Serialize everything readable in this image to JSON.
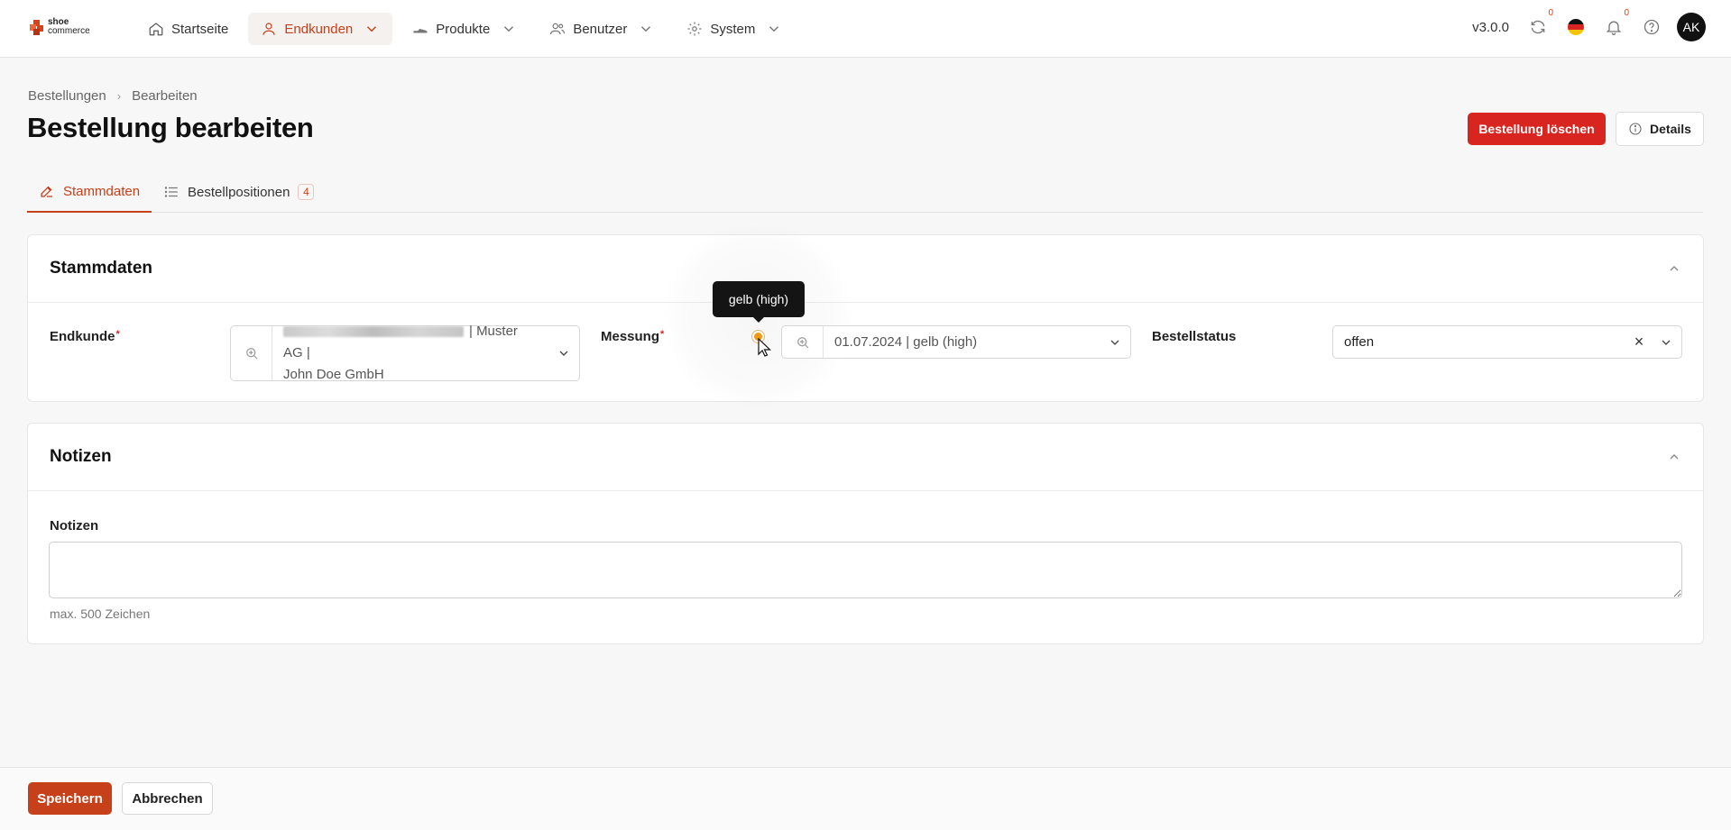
{
  "brand": {
    "line1": "shoe",
    "line2": "commerce"
  },
  "nav": {
    "items": [
      {
        "label": "Startseite",
        "icon": "home-icon"
      },
      {
        "label": "Endkunden",
        "icon": "user-icon",
        "active": true
      },
      {
        "label": "Produkte",
        "icon": "shoe-icon"
      },
      {
        "label": "Benutzer",
        "icon": "users-icon"
      },
      {
        "label": "System",
        "icon": "gear-icon"
      }
    ],
    "version": "v3.0.0",
    "sync_count": "0",
    "notification_count": "0",
    "avatar_initials": "AK"
  },
  "breadcrumb": {
    "parent": "Bestellungen",
    "current": "Bearbeiten"
  },
  "header": {
    "title": "Bestellung bearbeiten",
    "delete_label": "Bestellung löschen",
    "details_label": "Details"
  },
  "tabs": [
    {
      "label": "Stammdaten",
      "icon": "edit-icon",
      "active": true
    },
    {
      "label": "Bestellpositionen",
      "icon": "list-icon",
      "count": "4"
    }
  ],
  "stammdaten": {
    "title": "Stammdaten",
    "endkunde": {
      "label": "Endkunde",
      "required": "*",
      "value_line1": "| Muster AG |",
      "value_line2": "John Doe GmbH"
    },
    "messung": {
      "label": "Messung",
      "required": "*",
      "value": "01.07.2024 | gelb (high)",
      "tooltip": "gelb (high)",
      "status_color": "#f09a13"
    },
    "bestellstatus": {
      "label": "Bestellstatus",
      "value": "offen"
    }
  },
  "notizen": {
    "title": "Notizen",
    "label": "Notizen",
    "value": "",
    "hint": "max. 500 Zeichen"
  },
  "footer": {
    "save_label": "Speichern",
    "cancel_label": "Abbrechen"
  },
  "colors": {
    "accent": "#c6401a",
    "danger": "#d8251f",
    "warning": "#f09a13"
  }
}
